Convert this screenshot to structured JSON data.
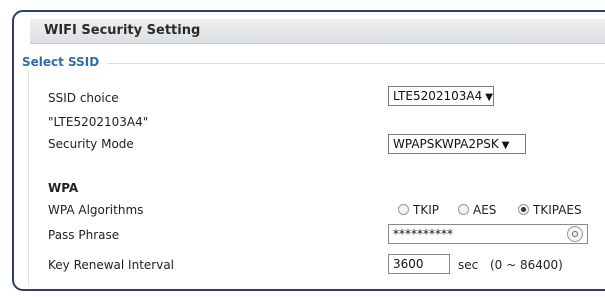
{
  "header": {
    "title": "WIFI Security Setting"
  },
  "section": {
    "legend": "Select SSID"
  },
  "ssid": {
    "label": "SSID choice",
    "value": "LTE5202103A4",
    "current_display": "\"LTE5202103A4\""
  },
  "security": {
    "label": "Security Mode",
    "value": "WPAPSKWPA2PSK"
  },
  "wpa": {
    "heading": "WPA",
    "algorithms_label": "WPA Algorithms",
    "algorithms": [
      {
        "label": "TKIP",
        "checked": false
      },
      {
        "label": "AES",
        "checked": false
      },
      {
        "label": "TKIPAES",
        "checked": true
      }
    ],
    "pass_phrase_label": "Pass Phrase",
    "pass_phrase_value": "**********",
    "renewal_label": "Key Renewal Interval",
    "renewal_value": "3600",
    "renewal_unit": "sec",
    "renewal_range": "(0 ~ 86400)"
  },
  "icons": {
    "select_arrow": "chevron-down-icon",
    "reveal": "eye-icon"
  }
}
